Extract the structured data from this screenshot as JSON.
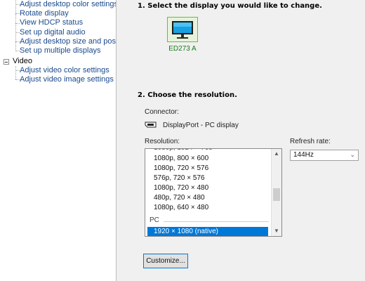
{
  "nav": {
    "display_items": [
      "Adjust desktop color settings",
      "Rotate display",
      "View HDCP status",
      "Set up digital audio",
      "Adjust desktop size and position",
      "Set up multiple displays"
    ],
    "video_category": "Video",
    "video_items": [
      "Adjust video color settings",
      "Adjust video image settings"
    ]
  },
  "section1": {
    "heading": "1. Select the display you would like to change.",
    "display_name": "ED273 A"
  },
  "section2": {
    "heading": "2. Choose the resolution.",
    "connector_label": "Connector:",
    "connector_value": "DisplayPort - PC display",
    "resolution_label": "Resolution:",
    "refresh_label": "Refresh rate:",
    "refresh_value": "144Hz",
    "resolution_options": [
      "1080p, 800 × 600",
      "1080p, 720 × 576",
      "576p, 720 × 576",
      "1080p, 720 × 480",
      "480p, 720 × 480",
      "1080p, 640 × 480"
    ],
    "resolution_group": "PC",
    "resolution_selected": "1920 × 1080 (native)",
    "customize_label": "Customize..."
  },
  "colors": {
    "link": "#1a4a8c",
    "selection": "#0078d7",
    "monitor_border": "#6cbb3c"
  }
}
